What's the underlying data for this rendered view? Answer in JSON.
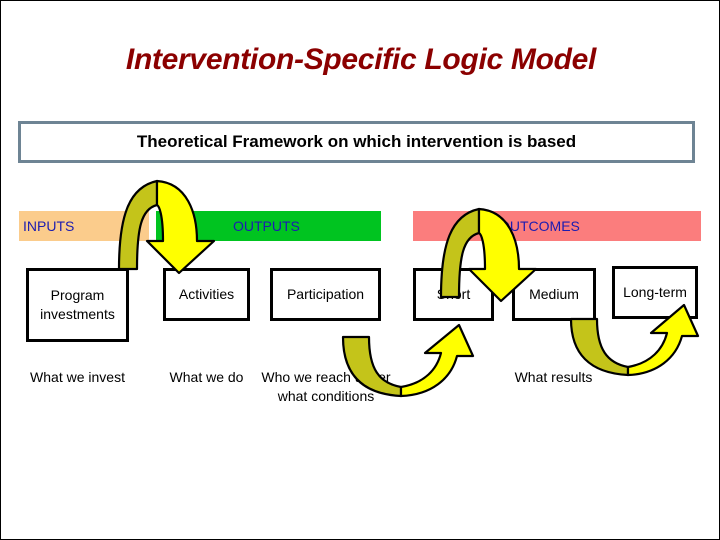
{
  "slide": {
    "title": "Intervention-Specific Logic Model",
    "framework_banner": "Theoretical Framework on which intervention is based"
  },
  "bands": [
    {
      "key": "inputs",
      "label": "INPUTS",
      "color": "#fbcc8c"
    },
    {
      "key": "outputs",
      "label": "OUTPUTS",
      "color": "#00c420"
    },
    {
      "key": "outcomes",
      "label": "OUTCOMES",
      "color": "#fb7d7d"
    }
  ],
  "boxes": {
    "program": "Program investments",
    "activities": "Activities",
    "participation": "Participation",
    "short": "Short",
    "medium": "Medium",
    "longterm": "Long-term"
  },
  "captions": {
    "invest": "What we invest",
    "do": "What we do",
    "reach": "Who we reach under what conditions",
    "results": "What results"
  },
  "colors": {
    "title": "#8b0000",
    "band_label": "#1c1cb0",
    "framework_border": "#6e8494",
    "arrow_light": "#ffff00",
    "arrow_dark": "#c4c41a",
    "box_border": "#000000"
  },
  "arrows": [
    {
      "name": "inputs-to-outputs",
      "direction": "down"
    },
    {
      "name": "short-to-medium",
      "direction": "down"
    },
    {
      "name": "participation-to-short",
      "direction": "up"
    },
    {
      "name": "medium-to-longterm",
      "direction": "up"
    }
  ]
}
